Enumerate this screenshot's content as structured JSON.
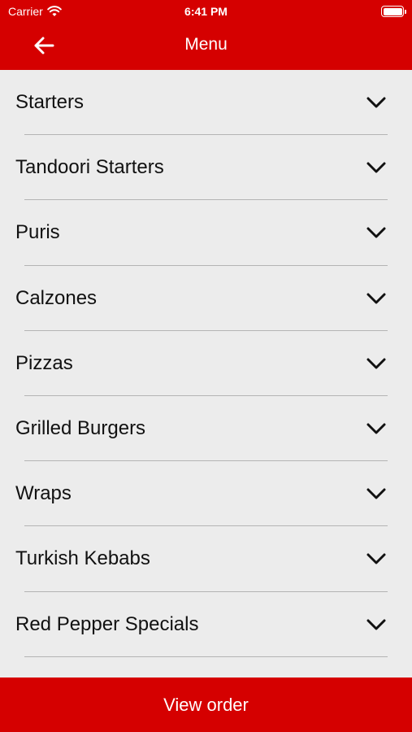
{
  "status_bar": {
    "carrier": "Carrier",
    "time": "6:41 PM"
  },
  "header": {
    "title": "Menu",
    "back_icon": "arrow-left-icon"
  },
  "menu": {
    "categories": [
      {
        "label": "Starters"
      },
      {
        "label": "Tandoori Starters"
      },
      {
        "label": "Puris"
      },
      {
        "label": "Calzones"
      },
      {
        "label": "Pizzas"
      },
      {
        "label": "Grilled Burgers"
      },
      {
        "label": "Wraps"
      },
      {
        "label": "Turkish Kebabs"
      },
      {
        "label": "Red Pepper Specials"
      }
    ],
    "expand_icon": "chevron-down-icon"
  },
  "footer": {
    "label": "View order"
  },
  "colors": {
    "brand": "#d50000",
    "background": "#ececec",
    "divider": "#b4b4b4"
  }
}
